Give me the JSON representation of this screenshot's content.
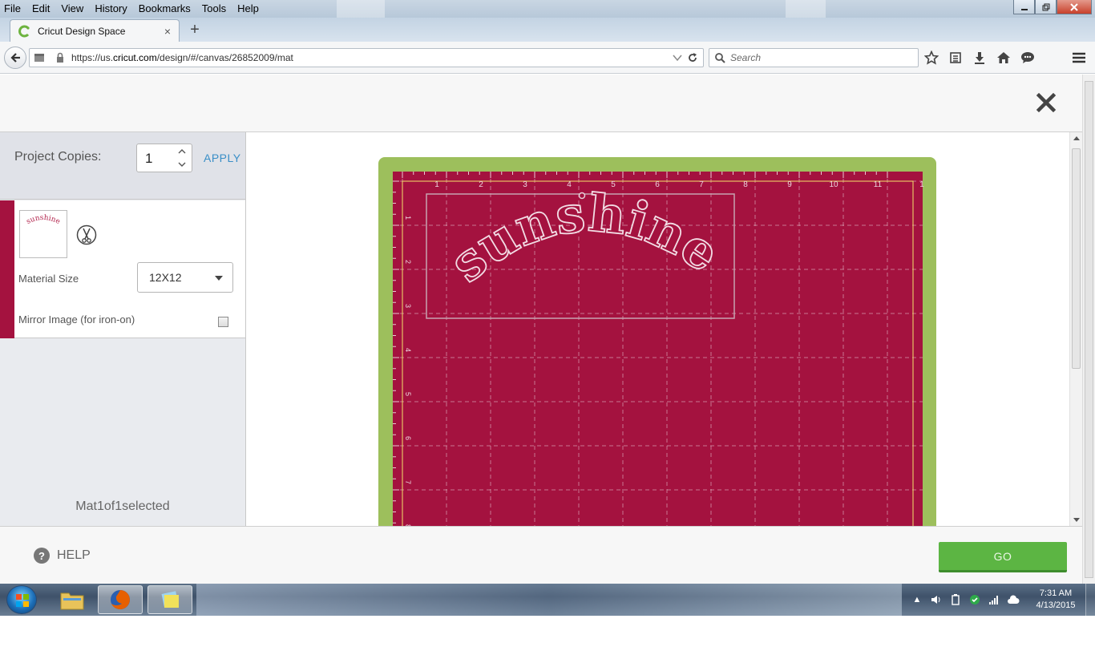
{
  "window": {
    "menu": [
      "File",
      "Edit",
      "View",
      "History",
      "Bookmarks",
      "Tools",
      "Help"
    ],
    "menu_accel": [
      "F",
      "E",
      "V",
      "s",
      "B",
      "T",
      "H"
    ]
  },
  "tab": {
    "title": "Cricut Design Space"
  },
  "nav": {
    "url_prefix": "https://us.",
    "url_domain": "cricut.com",
    "url_path": "/design/#/canvas/26852009/mat",
    "search_placeholder": "Search"
  },
  "panel": {
    "copies_label": "Project Copies:",
    "copies_value": "1",
    "apply_label": "APPLY",
    "thumb_text": "sunshine",
    "material_size_label": "Material Size",
    "material_size_value": "12X12",
    "mirror_label": "Mirror Image (for iron-on)",
    "mat_count": "Mat1of1selected"
  },
  "mat": {
    "design_text": "sunshine",
    "top_ruler": [
      "1",
      "2",
      "3",
      "4",
      "5",
      "6",
      "7",
      "8",
      "9",
      "10",
      "11",
      "1"
    ],
    "left_ruler": [
      "1",
      "2",
      "3",
      "4",
      "5",
      "6",
      "7",
      "8"
    ],
    "colors": {
      "mat": "#a4123f",
      "mat_border": "#9dbf5c",
      "grid": "#e8c9d3",
      "guide": "#f3e36b"
    }
  },
  "footer": {
    "help_label": "HELP",
    "go_label": "GO"
  },
  "taskbar": {
    "time": "7:31 AM",
    "date": "4/13/2015"
  }
}
